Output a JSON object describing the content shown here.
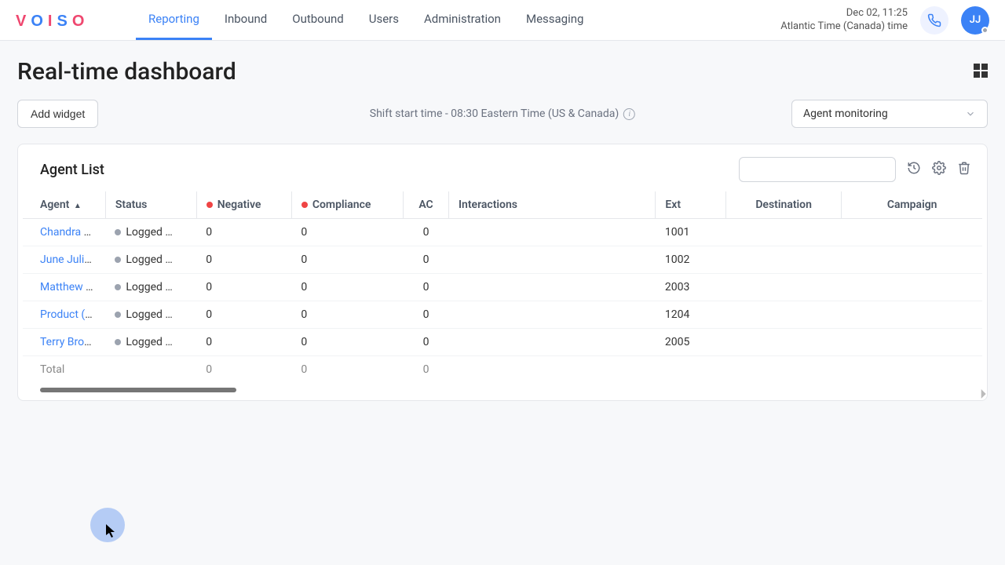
{
  "header": {
    "nav": [
      "Reporting",
      "Inbound",
      "Outbound",
      "Users",
      "Administration",
      "Messaging"
    ],
    "active_nav_index": 0,
    "date_line": "Dec 02, 11:25",
    "tz_line": "Atlantic Time (Canada) time",
    "avatar_initials": "JJ"
  },
  "page": {
    "title": "Real-time dashboard",
    "add_widget_label": "Add widget",
    "shift_text": "Shift start time - 08:30 Eastern Time (US & Canada)",
    "selector_value": "Agent monitoring"
  },
  "widget": {
    "title": "Agent List",
    "columns": {
      "agent": "Agent",
      "status": "Status",
      "negative": "Negative",
      "compliance": "Compliance",
      "ac": "AC",
      "interactions": "Interactions",
      "ext": "Ext",
      "destination": "Destination",
      "campaign": "Campaign"
    },
    "rows": [
      {
        "agent": "Chandra Ag…",
        "status": "Logged …",
        "negative": "0",
        "compliance": "0",
        "ac": "0",
        "interactions": "",
        "ext": "1001",
        "destination": "",
        "campaign": ""
      },
      {
        "agent": "June Juliette",
        "status": "Logged …",
        "negative": "0",
        "compliance": "0",
        "ac": "0",
        "interactions": "",
        "ext": "1002",
        "destination": "",
        "campaign": ""
      },
      {
        "agent": "Matthew W…",
        "status": "Logged …",
        "negative": "0",
        "compliance": "0",
        "ac": "0",
        "interactions": "",
        "ext": "2003",
        "destination": "",
        "campaign": ""
      },
      {
        "agent": "Product (E.B.)",
        "status": "Logged …",
        "negative": "0",
        "compliance": "0",
        "ac": "0",
        "interactions": "",
        "ext": "1204",
        "destination": "",
        "campaign": ""
      },
      {
        "agent": "Terry Brown",
        "status": "Logged …",
        "negative": "0",
        "compliance": "0",
        "ac": "0",
        "interactions": "",
        "ext": "2005",
        "destination": "",
        "campaign": ""
      }
    ],
    "total": {
      "label": "Total",
      "negative": "0",
      "compliance": "0",
      "ac": "0"
    }
  }
}
